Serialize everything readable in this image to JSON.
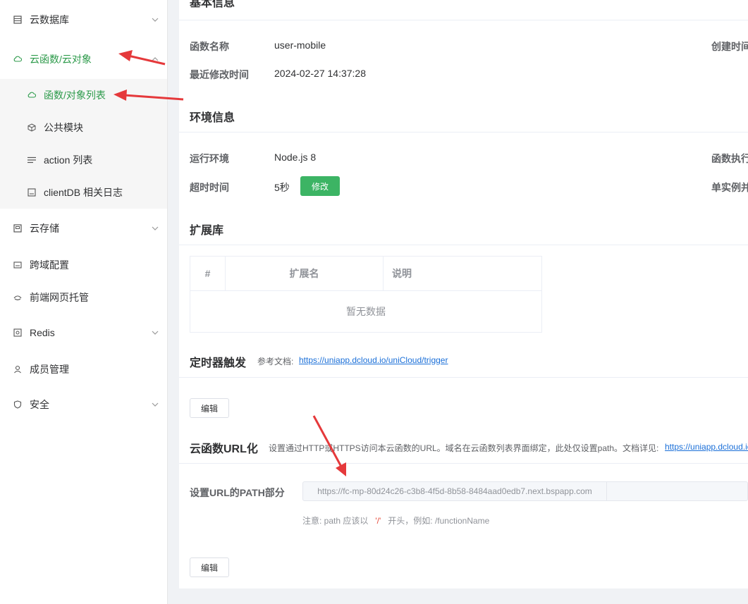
{
  "sidebar": {
    "items": [
      {
        "label": "云数据库",
        "icon": "database-icon"
      },
      {
        "label": "云函数/云对象",
        "icon": "cloud-icon"
      },
      {
        "label": "云存储",
        "icon": "storage-icon"
      },
      {
        "label": "跨域配置",
        "icon": "cors-icon"
      },
      {
        "label": "前端网页托管",
        "icon": "hosting-icon"
      },
      {
        "label": "Redis",
        "icon": "redis-icon"
      },
      {
        "label": "成员管理",
        "icon": "user-icon"
      },
      {
        "label": "安全",
        "icon": "shield-icon"
      }
    ],
    "submenu": [
      {
        "label": "函数/对象列表",
        "icon": "cloud-icon"
      },
      {
        "label": "公共模块",
        "icon": "cube-icon"
      },
      {
        "label": "action 列表",
        "icon": "list-icon"
      },
      {
        "label": "clientDB 相关日志",
        "icon": "log-icon"
      }
    ]
  },
  "basic": {
    "title": "基本信息",
    "name_label": "函数名称",
    "name_value": "user-mobile",
    "created_label": "创建时间",
    "modified_label": "最近修改时间",
    "modified_value": "2024-02-27 14:37:28"
  },
  "env": {
    "title": "环境信息",
    "runtime_label": "运行环境",
    "runtime_value": "Node.js 8",
    "exec_label": "函数执行",
    "timeout_label": "超时时间",
    "timeout_value": "5秒",
    "edit_label": "修改",
    "concurrency_label": "单实例并"
  },
  "ext": {
    "title": "扩展库",
    "columns": [
      "#",
      "扩展名",
      "说明"
    ],
    "empty_text": "暂无数据"
  },
  "timer": {
    "title": "定时器触发",
    "doc_prefix": "参考文档:",
    "doc_link": "https://uniapp.dcloud.io/uniCloud/trigger",
    "edit_label": "编辑"
  },
  "url": {
    "title": "云函数URL化",
    "desc": "设置通过HTTP或HTTPS访问本云函数的URL。域名在云函数列表界面绑定，此处仅设置path。文档详见:",
    "doc_link": "https://uniapp.dcloud.io",
    "path_label": "设置URL的PATH部分",
    "path_prefix": "https://fc-mp-80d24c26-c3b8-4f5d-8b58-8484aad0edb7.next.bspapp.com",
    "hint_prefix": "注意: path 应该以",
    "hint_slash": "'/'",
    "hint_suffix": "开头，例如: /functionName",
    "edit_label": "编辑"
  },
  "colors": {
    "accent": "#2c9a4a",
    "button_green": "#3cb464",
    "arrow": "#e5393b",
    "link": "#1a6fd8"
  }
}
